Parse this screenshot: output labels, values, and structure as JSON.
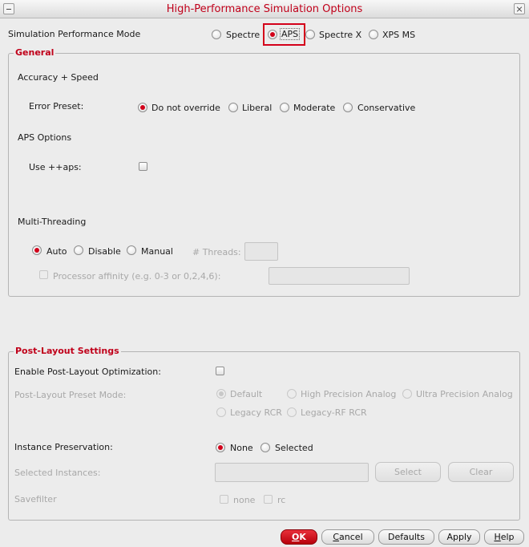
{
  "window": {
    "title": "High-Performance Simulation Options"
  },
  "mode": {
    "label": "Simulation Performance Mode",
    "options": [
      "Spectre",
      "APS",
      "Spectre X",
      "XPS MS"
    ],
    "selected": "APS"
  },
  "general": {
    "title": "General",
    "accuracy_heading": "Accuracy + Speed",
    "error_preset_label": "Error Preset:",
    "error_preset_options": [
      "Do not override",
      "Liberal",
      "Moderate",
      "Conservative"
    ],
    "error_preset_selected": "Do not override",
    "aps_options_heading": "APS Options",
    "use_aps_label": "Use ++aps:",
    "use_aps_checked": false,
    "multithreading_heading": "Multi-Threading",
    "threading_options": [
      "Auto",
      "Disable",
      "Manual"
    ],
    "threading_selected": "Auto",
    "threads_label": "# Threads:",
    "threads_value": "",
    "affinity_label": "Processor affinity (e.g. 0-3 or 0,2,4,6):",
    "affinity_value": ""
  },
  "postlayout": {
    "title": "Post-Layout Settings",
    "enable_label": "Enable Post-Layout Optimization:",
    "enable_checked": false,
    "preset_label": "Post-Layout Preset Mode:",
    "preset_options": [
      "Default",
      "High Precision Analog",
      "Ultra Precision Analog",
      "Legacy RCR",
      "Legacy-RF RCR"
    ],
    "preset_selected": "Default",
    "instance_label": "Instance Preservation:",
    "instance_options": [
      "None",
      "Selected"
    ],
    "instance_selected": "None",
    "selected_instances_label": "Selected Instances:",
    "selected_instances_value": "",
    "select_button": "Select",
    "clear_button": "Clear",
    "savefilter_label": "Savefilter",
    "savefilter_options": [
      "none",
      "rc"
    ]
  },
  "footer": {
    "ok_underline": "O",
    "ok_rest": "K",
    "cancel_underline": "C",
    "cancel_rest": "ancel",
    "defaults": "Defaults",
    "apply": "Apply",
    "help_underline": "H",
    "help_rest": "elp"
  },
  "colors": {
    "accent": "#c0001a",
    "highlight_box": "#d4001a",
    "ok_button": "#d01020"
  }
}
